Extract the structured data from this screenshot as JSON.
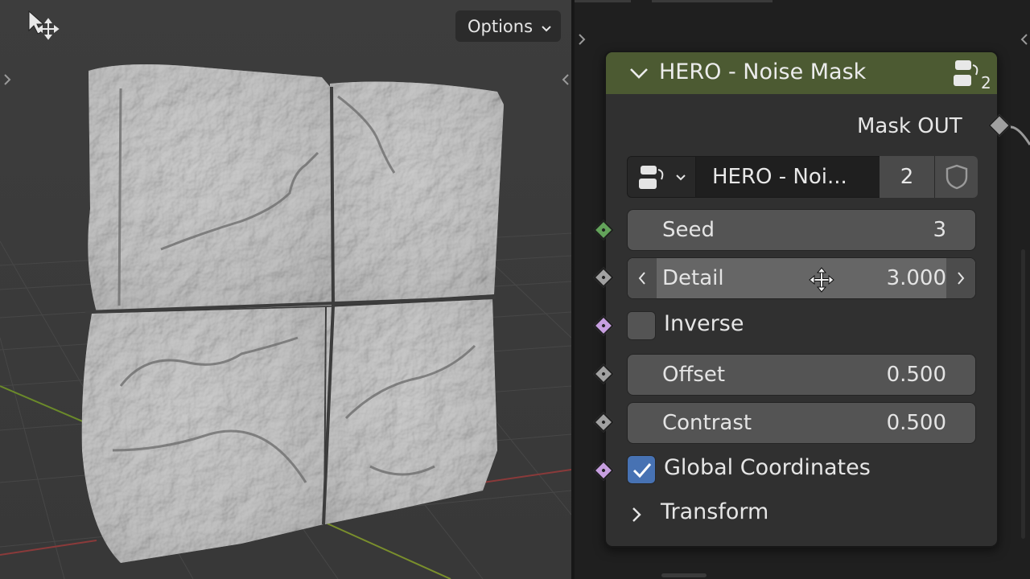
{
  "viewport": {
    "options_label": "Options"
  },
  "node": {
    "title": "HERO - Noise Mask",
    "user_count": "2",
    "output_socket": "Mask OUT",
    "group_name": "HERO - Noi...",
    "group_users": "2",
    "header_color": "#4c5a32",
    "inputs": [
      {
        "label": "Seed",
        "value": "3",
        "socket_color": "#63a35a"
      },
      {
        "label": "Detail",
        "value": "3.000",
        "socket_color": "#a1a1a1"
      },
      {
        "label": "Inverse",
        "socket_color": "#c79fe0"
      },
      {
        "label": "Offset",
        "value": "0.500",
        "socket_color": "#a1a1a1"
      },
      {
        "label": "Contrast",
        "value": "0.500",
        "socket_color": "#a1a1a1"
      },
      {
        "label": "Global Coordinates",
        "socket_color": "#c79fe0"
      }
    ],
    "panel": {
      "label": "Transform"
    }
  }
}
